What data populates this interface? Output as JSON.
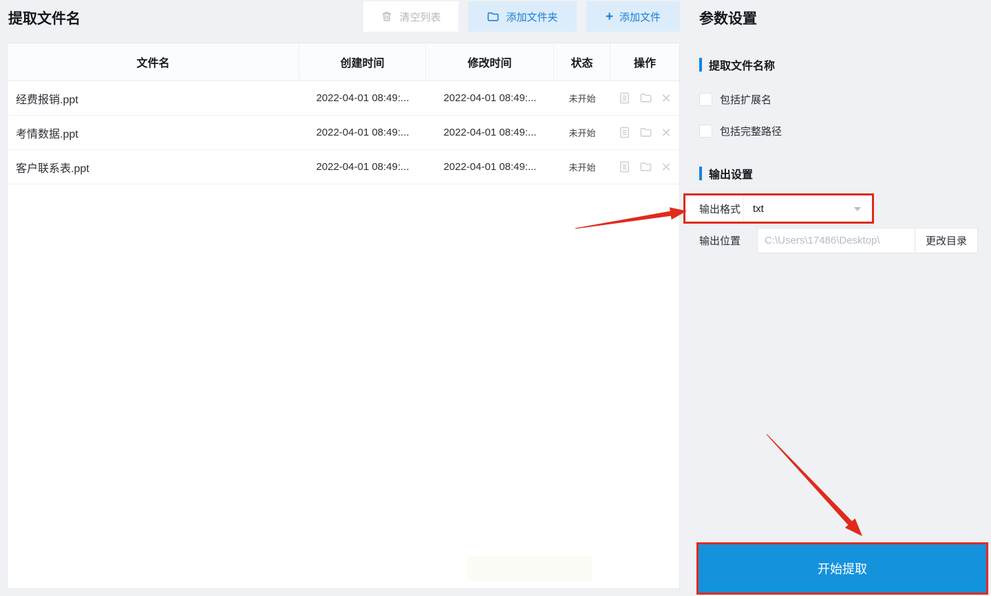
{
  "page": {
    "title": "提取文件名"
  },
  "toolbar": {
    "clear_list": "清空列表",
    "add_folder": "添加文件夹",
    "add_file": "添加文件"
  },
  "table": {
    "columns": [
      "文件名",
      "创建时间",
      "修改时间",
      "状态",
      "操作"
    ],
    "rows": [
      {
        "name": "经费报销.ppt",
        "created": "2022-04-01 08:49:...",
        "modified": "2022-04-01 08:49:...",
        "status": "未开始"
      },
      {
        "name": "考情数据.ppt",
        "created": "2022-04-01 08:49:...",
        "modified": "2022-04-01 08:49:...",
        "status": "未开始"
      },
      {
        "name": "客户联系表.ppt",
        "created": "2022-04-01 08:49:...",
        "modified": "2022-04-01 08:49:...",
        "status": "未开始"
      }
    ],
    "row_icons": [
      "document-icon",
      "folder-icon",
      "remove-icon"
    ]
  },
  "settings": {
    "title": "参数设置",
    "section_extract": "提取文件名称",
    "checkbox_extension": "包括扩展名",
    "checkbox_fullpath": "包括完整路径",
    "section_output": "输出设置",
    "format_label": "输出格式",
    "format_value": "txt",
    "location_label": "输出位置",
    "location_value": "C:\\Users\\17486\\Desktop\\",
    "change_dir": "更改目录",
    "start": "开始提取"
  },
  "colors": {
    "accent_blue": "#1583e0",
    "start_button_blue": "#1592dc",
    "light_blue_button_bg": "#dcecfa",
    "light_blue_button_text": "#1a7fd4",
    "annotation_red": "#e02a1c"
  }
}
